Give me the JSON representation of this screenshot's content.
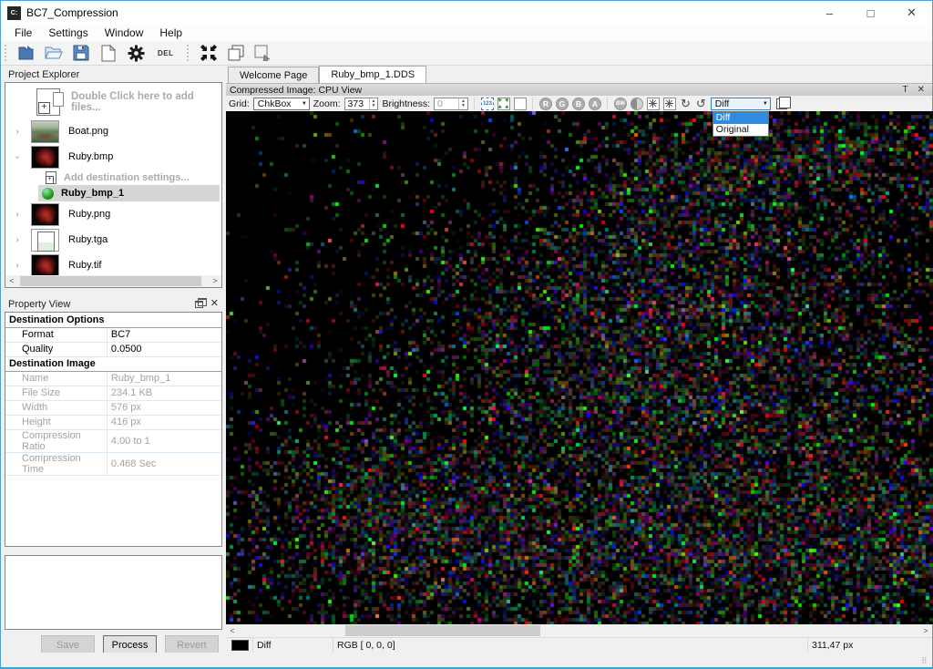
{
  "window": {
    "title": "BC7_Compression",
    "icon_label": "C:",
    "controls": {
      "minimize": "–",
      "maximize": "□",
      "close": "✕"
    }
  },
  "menu": {
    "items": [
      "File",
      "Settings",
      "Window",
      "Help"
    ]
  },
  "toolbar": {
    "del_label": "DEL"
  },
  "project_explorer": {
    "title": "Project Explorer",
    "rows": [
      {
        "label": "Double Click here to add files..."
      },
      {
        "label": "Boat.png",
        "expander": "›"
      },
      {
        "label": "Ruby.bmp",
        "expander": "›"
      },
      {
        "label": "Add destination settings..."
      },
      {
        "label": "Ruby_bmp_1"
      },
      {
        "label": "Ruby.png",
        "expander": "›"
      },
      {
        "label": "Ruby.tga",
        "expander": "›"
      },
      {
        "label": "Ruby.tif",
        "expander": "›"
      }
    ]
  },
  "property_view": {
    "title": "Property View",
    "rows": [
      {
        "header": "Destination Options"
      },
      {
        "label": "Format",
        "value": "BC7"
      },
      {
        "label": "Quality",
        "value": "0.0500"
      },
      {
        "header": "Destination Image"
      },
      {
        "label": "Name",
        "value": "Ruby_bmp_1"
      },
      {
        "label": "File Size",
        "value": "234.1 KB"
      },
      {
        "label": "Width",
        "value": "576 px"
      },
      {
        "label": "Height",
        "value": "416 px"
      },
      {
        "label": "Compression Ratio",
        "value": "4.00 to 1"
      },
      {
        "label": "Compression Time",
        "value": "0.468 Sec"
      }
    ],
    "buttons": {
      "save": "Save",
      "process": "Process",
      "revert": "Revert"
    }
  },
  "main": {
    "tabs": [
      {
        "label": "Welcome Page"
      },
      {
        "label": "Ruby_bmp_1.DDS"
      }
    ],
    "view_title": "Compressed Image: CPU View",
    "view_buttons": {
      "toggle": "T",
      "close": "✕"
    },
    "view_toolbar": {
      "grid_label": "Grid:",
      "grid_value": "ChkBox",
      "zoom_label": "Zoom:",
      "zoom_value": "373",
      "brightness_label": "Brightness:",
      "brightness_value": "0",
      "channels": [
        "R",
        "G",
        "B",
        "A"
      ],
      "bw_label": "BW",
      "block_icon_label": "123",
      "rotate_right": "↻",
      "rotate_left": "↺",
      "mode_value": "Diff",
      "mode_options": [
        "Diff",
        "Original"
      ]
    },
    "status_bar": {
      "swatch_color": "#000000",
      "mode": "Diff",
      "rgb": "RGB [ 0,  0,  0]",
      "cursor": "311,47 px"
    }
  }
}
